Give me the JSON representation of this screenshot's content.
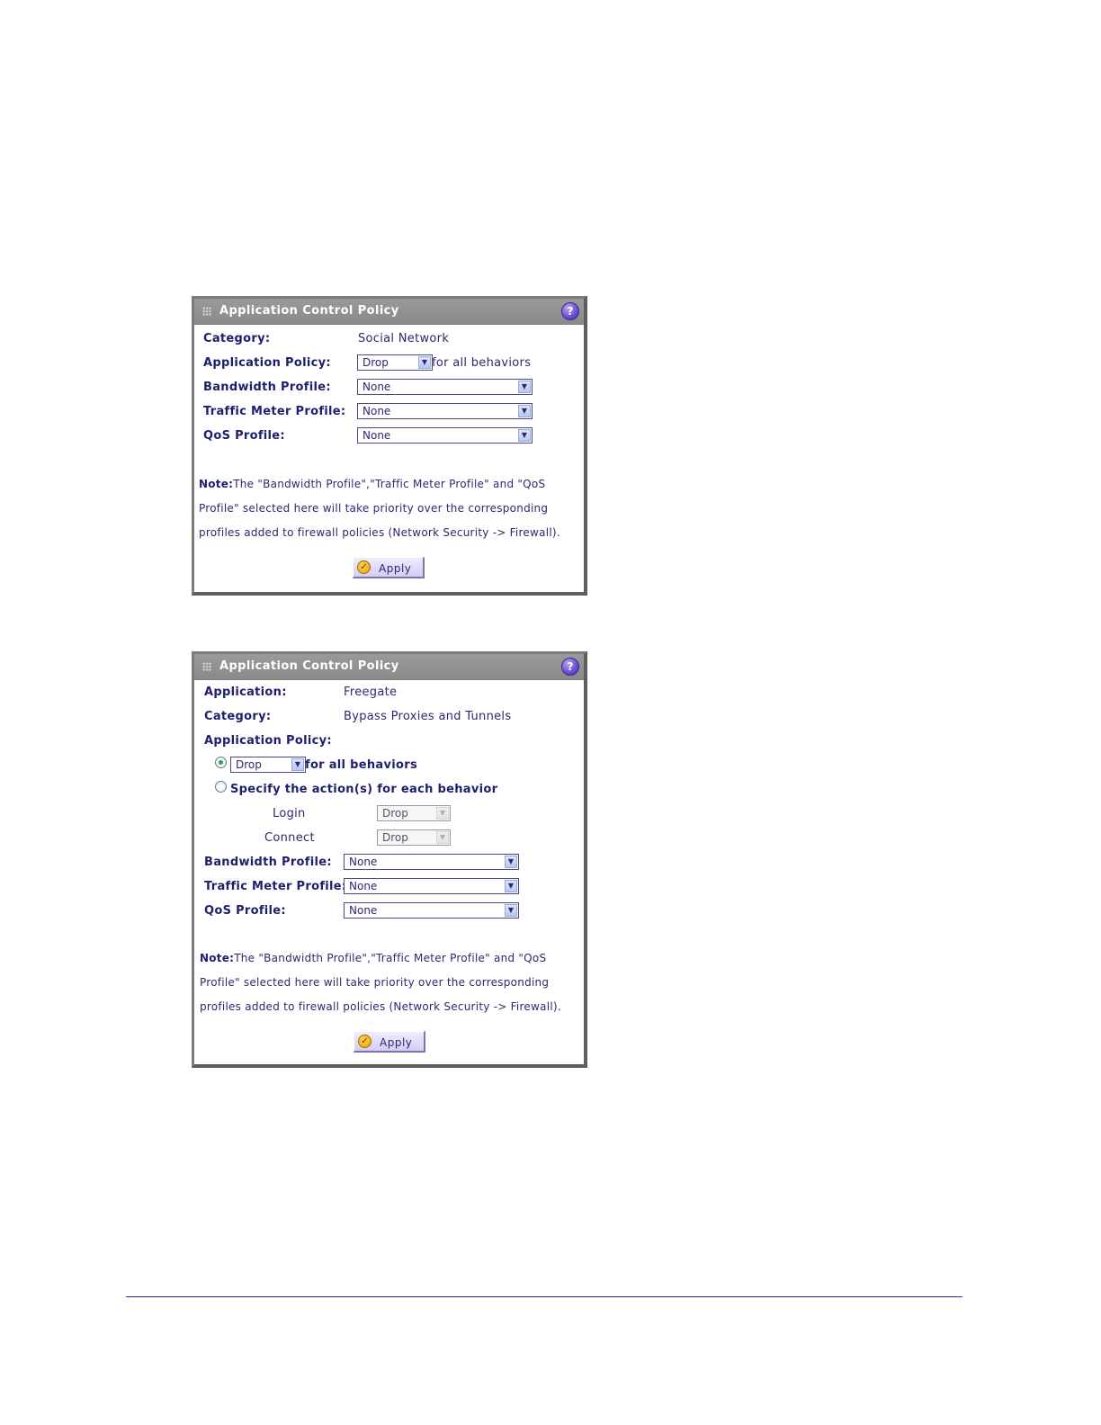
{
  "panel1": {
    "title": "Application Control Policy",
    "help_icon": "?",
    "category_label": "Category:",
    "category_value": "Social Network",
    "app_policy_label": "Application Policy:",
    "app_policy_value": "Drop",
    "app_policy_suffix": "for all behaviors",
    "bandwidth_label": "Bandwidth Profile:",
    "bandwidth_value": "None",
    "traffic_label": "Traffic Meter Profile:",
    "traffic_value": "None",
    "qos_label": "QoS Profile:",
    "qos_value": "None",
    "note_label": "Note:",
    "note_text": "The \"Bandwidth Profile\",\"Traffic Meter Profile\" and \"QoS Profile\" selected here will take priority over the corresponding profiles added to firewall policies (Network Security -> Firewall).",
    "apply_label": "Apply"
  },
  "panel2": {
    "title": "Application Control Policy",
    "help_icon": "?",
    "application_label": "Application:",
    "application_value": "Freegate",
    "category_label": "Category:",
    "category_value": "Bypass Proxies and Tunnels",
    "app_policy_label": "Application Policy:",
    "radio_all_checked": true,
    "all_policy_value": "Drop",
    "all_policy_suffix": "for all behaviors",
    "specify_label": "Specify the action(s) for each behavior",
    "login_label": "Login",
    "login_value": "Drop",
    "connect_label": "Connect",
    "connect_value": "Drop",
    "bandwidth_label": "Bandwidth Profile:",
    "bandwidth_value": "None",
    "traffic_label": "Traffic Meter Profile:",
    "traffic_value": "None",
    "qos_label": "QoS Profile:",
    "qos_value": "None",
    "note_label": "Note:",
    "note_text": "The \"Bandwidth Profile\",\"Traffic Meter Profile\" and \"QoS Profile\" selected here will take priority over the corresponding profiles added to firewall policies (Network Security -> Firewall).",
    "apply_label": "Apply"
  },
  "icons": {
    "grip": "grip-dots-icon",
    "help": "help-question-icon",
    "dropdown": "chevron-down-icon",
    "apply": "checkmark-circle-icon"
  },
  "colors": {
    "header_bg": "#8e8e8e",
    "label_text": "#1e1e6e",
    "value_text": "#2a2a70",
    "help_icon": "#6a4bd2",
    "radio_selected": "#2fa83a",
    "footer_rule": "#2a2aa0"
  }
}
